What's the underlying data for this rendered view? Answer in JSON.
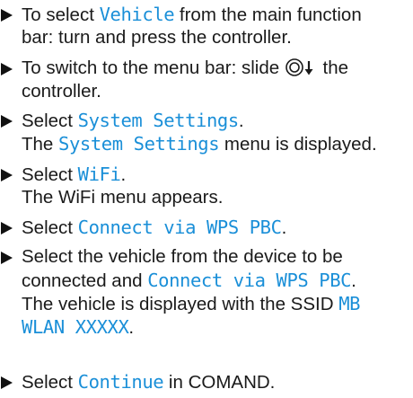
{
  "steps": [
    {
      "lines": [
        {
          "pre": "To select ",
          "ui": "Vehicle",
          "post": " from the main function"
        },
        {
          "text": "bar: turn and press the controller."
        }
      ]
    },
    {
      "lines": [
        {
          "pre": "To switch to the menu bar: slide ",
          "post": " the"
        },
        {
          "text": "controller."
        }
      ],
      "icons": [
        "controller-icon",
        "arrow-down-icon"
      ]
    },
    {
      "lines": [
        {
          "pre": "Select ",
          "ui": "System Settings",
          "post": "."
        },
        {
          "pre": "The ",
          "ui": "System Settings",
          "post": " menu is displayed."
        }
      ]
    },
    {
      "lines": [
        {
          "pre": "Select ",
          "ui": "WiFi",
          "post": "."
        },
        {
          "text": "The WiFi menu appears."
        }
      ]
    },
    {
      "lines": [
        {
          "pre": "Select ",
          "ui": "Connect via WPS PBC",
          "post": "."
        }
      ]
    },
    {
      "lines": [
        {
          "text": "Select the vehicle from the device to be"
        },
        {
          "pre": "connected and ",
          "ui": "Connect via WPS PBC",
          "post": "."
        },
        {
          "pre": "The vehicle is displayed with the SSID ",
          "ui": "MB"
        },
        {
          "ui": "WLAN XXXXX",
          "post": "."
        }
      ]
    },
    {
      "lines": [
        {
          "pre": "Select ",
          "ui": "Continue",
          "post": " in COMAND."
        }
      ]
    }
  ],
  "colors": {
    "ui_term": "#1a8fd8",
    "text": "#1a1a1a"
  }
}
